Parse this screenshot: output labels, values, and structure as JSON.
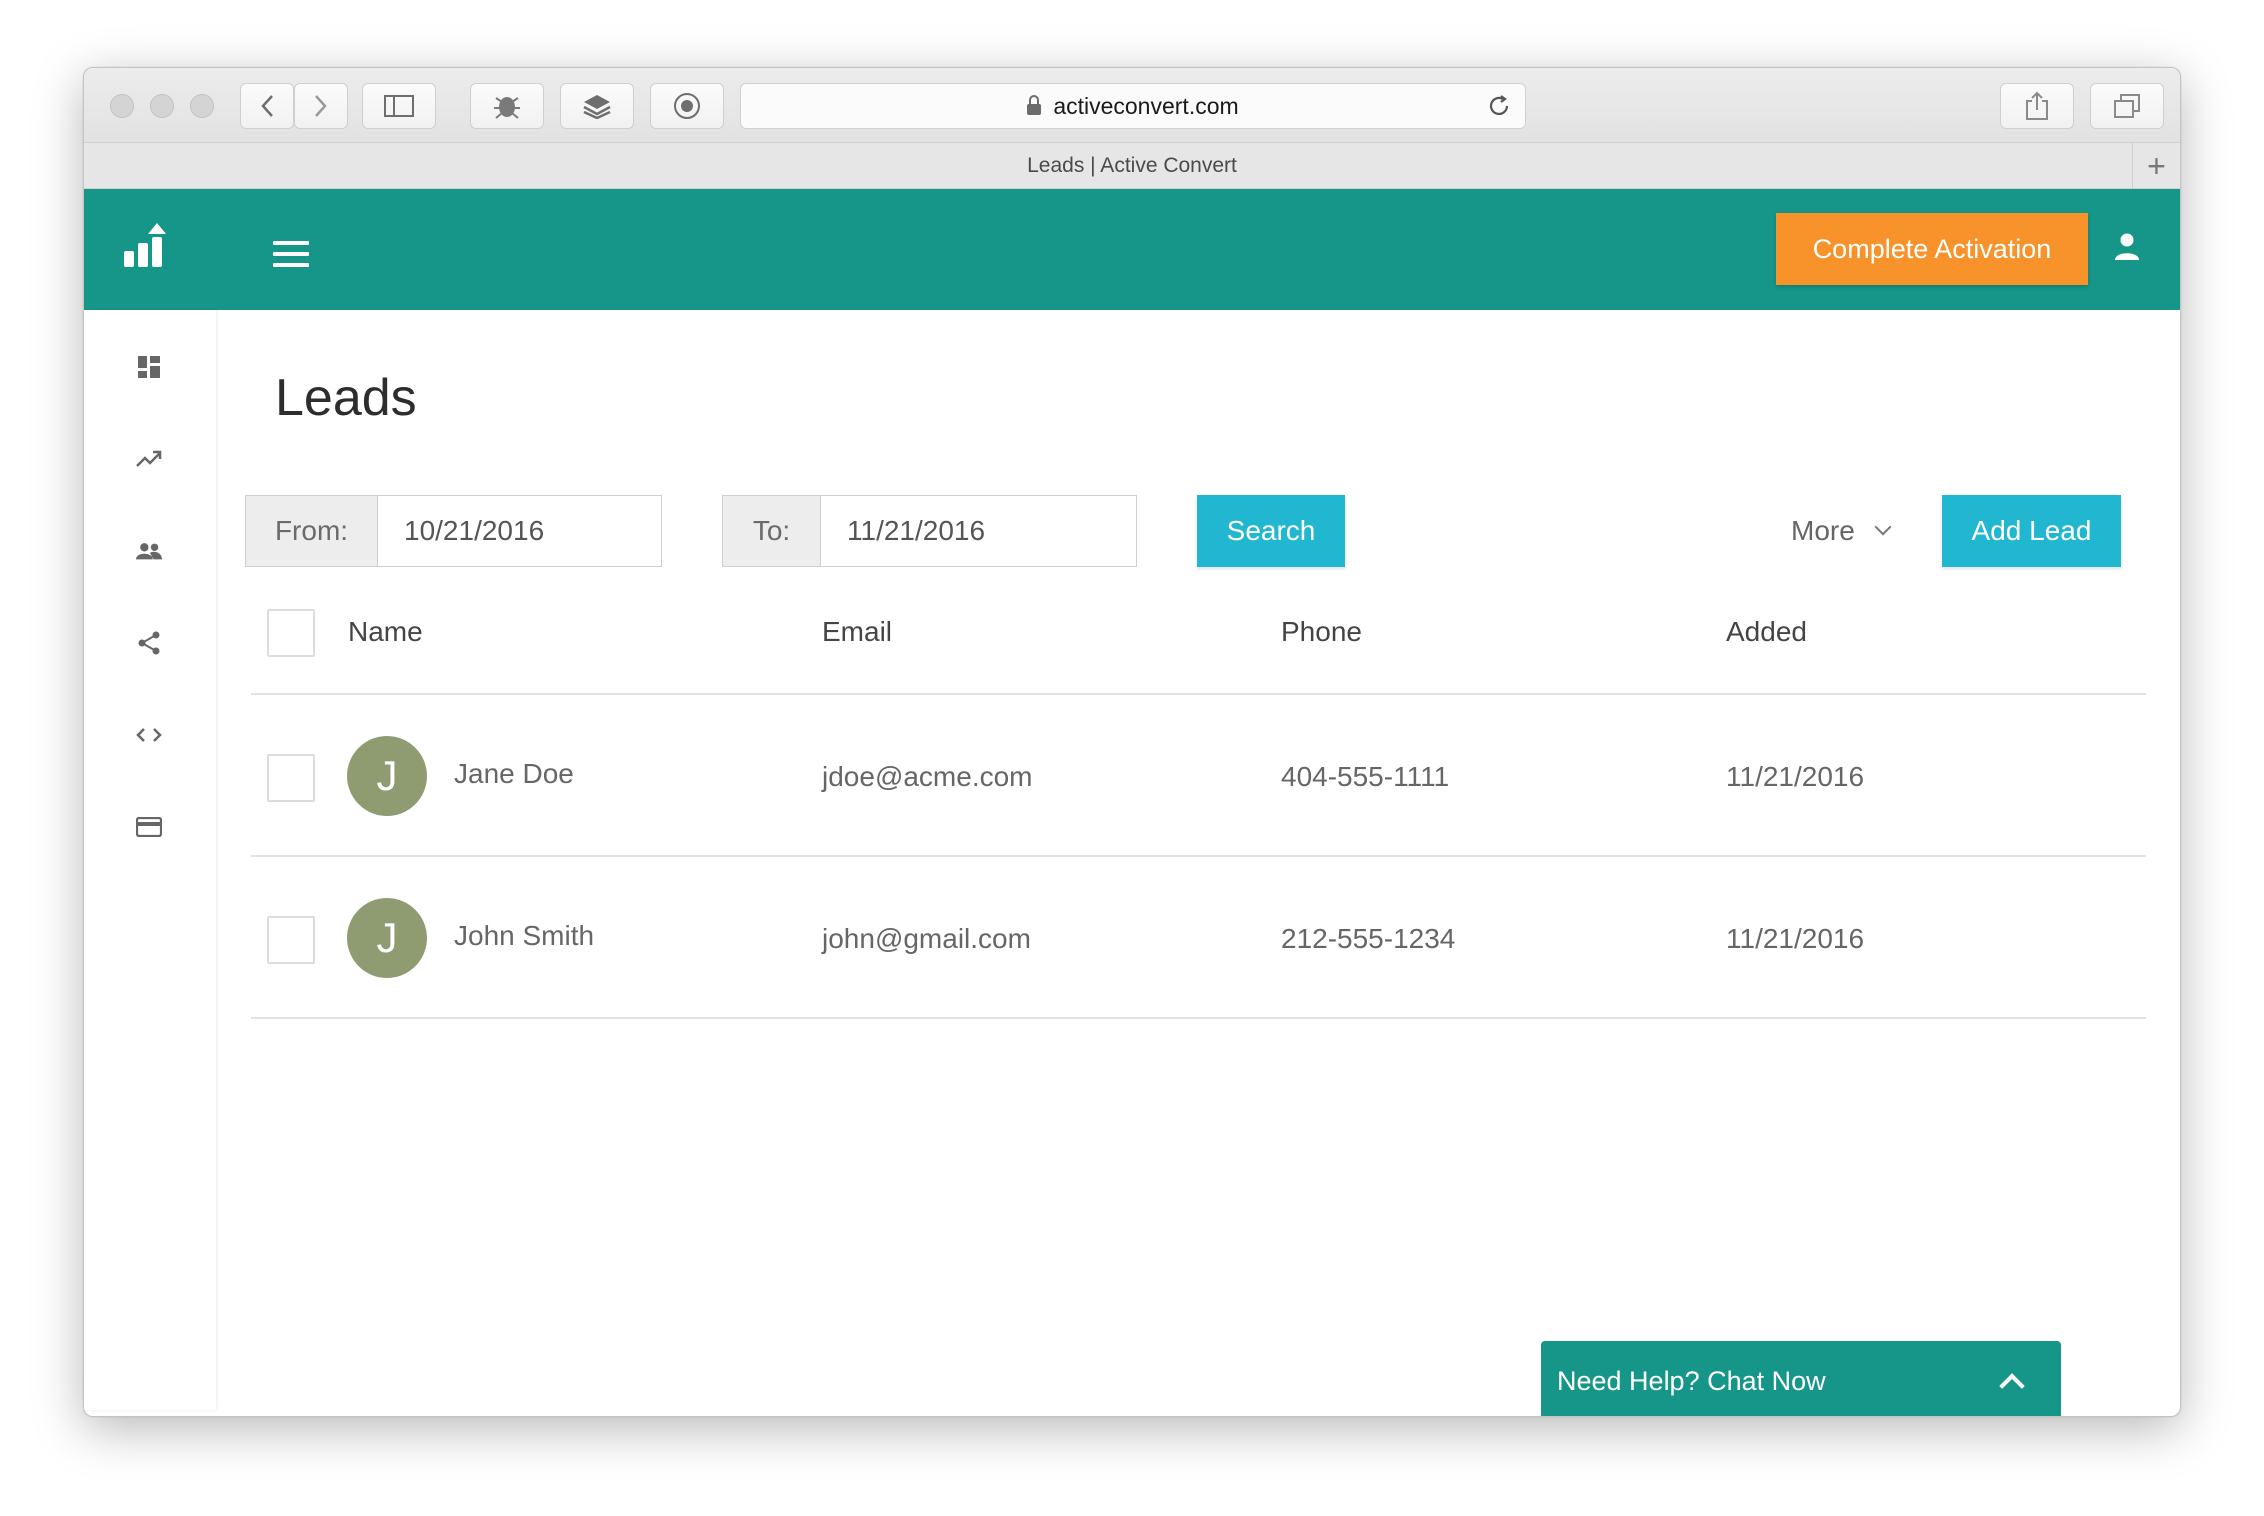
{
  "browser": {
    "url": "activeconvert.com",
    "tab_title": "Leads | Active Convert",
    "new_tab_glyph": "+"
  },
  "header": {
    "logo_icon": "bar-chart-up-icon",
    "menu_icon": "hamburger-icon",
    "activation_label": "Complete Activation",
    "user_icon": "person-icon",
    "accent_color": "#169688",
    "activation_color": "#f8932b"
  },
  "sidebar": {
    "items": [
      {
        "icon": "dashboard-icon"
      },
      {
        "icon": "trending-up-icon"
      },
      {
        "icon": "people-icon"
      },
      {
        "icon": "share-icon"
      },
      {
        "icon": "code-icon"
      },
      {
        "icon": "credit-card-icon"
      }
    ]
  },
  "page": {
    "title": "Leads"
  },
  "filters": {
    "from_label": "From:",
    "from_value": "10/21/2016",
    "to_label": "To:",
    "to_value": "11/21/2016",
    "search_label": "Search",
    "more_label": "More",
    "add_lead_label": "Add Lead",
    "button_color": "#22b7d0"
  },
  "table": {
    "columns": [
      "Name",
      "Email",
      "Phone",
      "Added"
    ],
    "rows": [
      {
        "initial": "J",
        "name": "Jane Doe",
        "email": "jdoe@acme.com",
        "phone": "404-555-1111",
        "added": "11/21/2016"
      },
      {
        "initial": "J",
        "name": "John Smith",
        "email": "john@gmail.com",
        "phone": "212-555-1234",
        "added": "11/21/2016"
      }
    ]
  },
  "chat": {
    "label": "Need Help? Chat Now"
  }
}
